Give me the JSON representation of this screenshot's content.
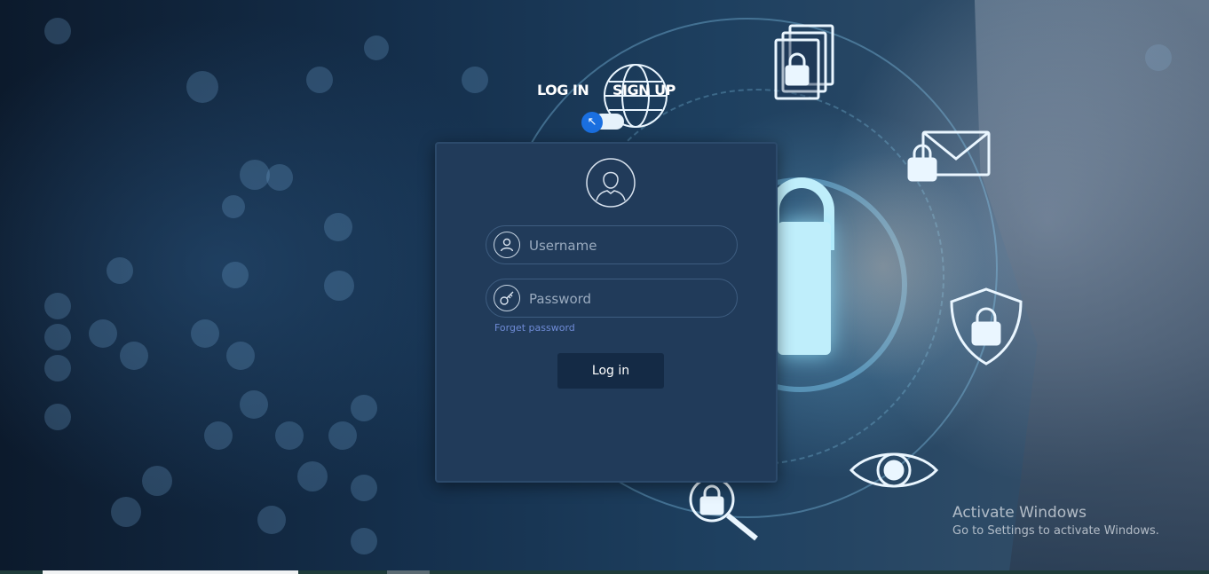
{
  "tabs": {
    "login_label": "LOG IN",
    "signup_label": "SIGN UP",
    "toggle_arrow": "↖"
  },
  "form": {
    "username_placeholder": "Username",
    "password_placeholder": "Password",
    "forget_label": "Forget password",
    "login_button_label": "Log in"
  },
  "watermark": {
    "title": "Activate Windows",
    "subtitle": "Go to Settings to activate Windows."
  },
  "icons": {
    "avatar": "user-avatar-icon",
    "username": "user-icon",
    "password": "key-icon",
    "background": [
      "documents-lock-icon",
      "mail-lock-icon",
      "shield-lock-icon",
      "eye-icon",
      "magnifier-lock-icon",
      "globe-icon"
    ]
  },
  "colors": {
    "card": "#213b5a",
    "button": "#142a45",
    "link": "#6f8bd6",
    "toggle_knob": "#1a6fe0"
  }
}
